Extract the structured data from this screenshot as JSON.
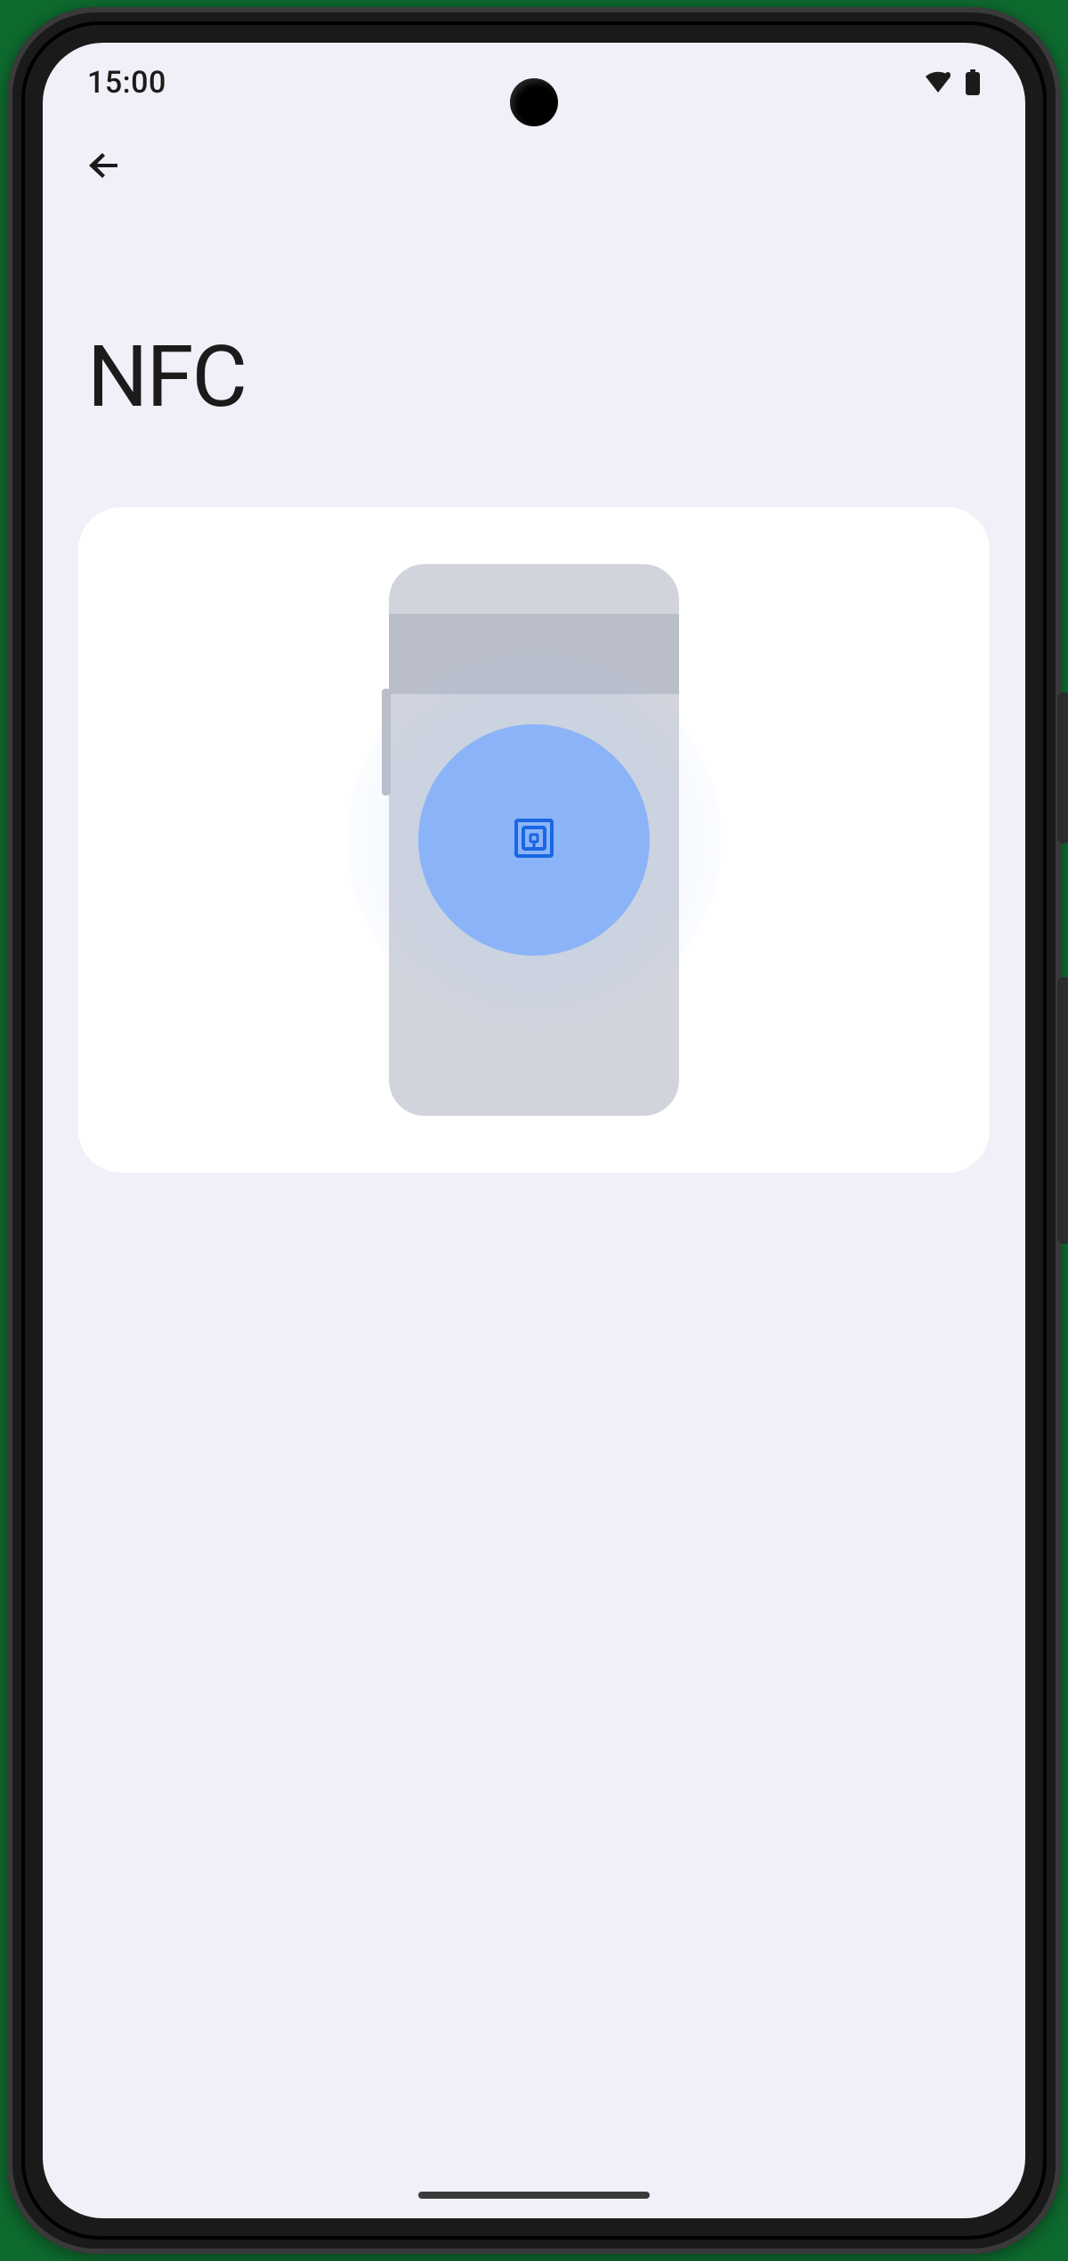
{
  "status_bar": {
    "time": "15:00",
    "icons": {
      "wifi_name": "wifi-icon",
      "battery_name": "battery-icon"
    }
  },
  "toolbar": {
    "back_name": "back-arrow-icon"
  },
  "page": {
    "title": "NFC"
  },
  "illustration": {
    "card_name": "nfc-illustration",
    "phone_name": "phone-back-graphic",
    "pulse_name": "nfc-pulse",
    "nfc_icon_name": "nfc-chip-icon",
    "colors": {
      "card_bg": "#ffffff",
      "phone_body": "#d1d4dc",
      "phone_header": "#b9bec8",
      "pulse_inner": "#8bb4f8",
      "nfc_stroke": "#1a66e3"
    }
  },
  "nav": {
    "handle_name": "gesture-nav-handle"
  }
}
